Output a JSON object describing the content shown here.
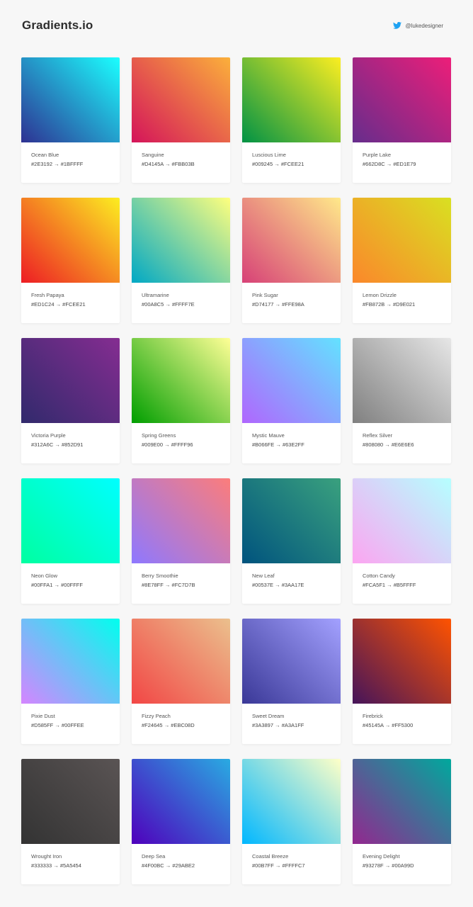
{
  "header": {
    "title": "Gradients.io",
    "twitter_handle": "@lukedesigner",
    "twitter_icon": "twitter-bird-icon",
    "twitter_color": "#1da1f2"
  },
  "gradients": [
    {
      "name": "Ocean Blue",
      "codes": "#2E3192 → #1BFFFF",
      "from": "#2E3192",
      "to": "#1BFFFF"
    },
    {
      "name": "Sanguine",
      "codes": "#D4145A → #FBB03B",
      "from": "#D4145A",
      "to": "#FBB03B"
    },
    {
      "name": "Luscious Lime",
      "codes": "#009245 → #FCEE21",
      "from": "#009245",
      "to": "#FCEE21"
    },
    {
      "name": "Purple Lake",
      "codes": "#662D8C → #ED1E79",
      "from": "#662D8C",
      "to": "#ED1E79"
    },
    {
      "name": "Fresh Papaya",
      "codes": "#ED1C24 → #FCEE21",
      "from": "#ED1C24",
      "to": "#FCEE21"
    },
    {
      "name": "Ultramarine",
      "codes": "#00A8C5 → #FFFF7E",
      "from": "#00A8C5",
      "to": "#FFFF7E"
    },
    {
      "name": "Pink Sugar",
      "codes": "#D74177 → #FFE98A",
      "from": "#D74177",
      "to": "#FFE98A"
    },
    {
      "name": "Lemon Drizzle",
      "codes": "#FB872B → #D9E021",
      "from": "#FB872B",
      "to": "#D9E021"
    },
    {
      "name": "Victoria Purple",
      "codes": "#312A6C → #852D91",
      "from": "#312A6C",
      "to": "#852D91"
    },
    {
      "name": "Spring Greens",
      "codes": "#009E00 → #FFFF96",
      "from": "#009E00",
      "to": "#FFFF96"
    },
    {
      "name": "Mystic Mauve",
      "codes": "#B066FE → #63E2FF",
      "from": "#B066FE",
      "to": "#63E2FF"
    },
    {
      "name": "Reflex Silver",
      "codes": "#808080 → #E6E6E6",
      "from": "#808080",
      "to": "#E6E6E6"
    },
    {
      "name": "Neon Glow",
      "codes": "#00FFA1 → #00FFFF",
      "from": "#00FFA1",
      "to": "#00FFFF"
    },
    {
      "name": "Berry Smoothie",
      "codes": "#8E78FF → #FC7D7B",
      "from": "#8E78FF",
      "to": "#FC7D7B"
    },
    {
      "name": "New Leaf",
      "codes": "#00537E → #3AA17E",
      "from": "#00537E",
      "to": "#3AA17E"
    },
    {
      "name": "Cotton Candy",
      "codes": "#FCA5F1 → #B5FFFF",
      "from": "#FCA5F1",
      "to": "#B5FFFF"
    },
    {
      "name": "Pixie Dust",
      "codes": "#D585FF → #00FFEE",
      "from": "#D585FF",
      "to": "#00FFEE"
    },
    {
      "name": "Fizzy Peach",
      "codes": "#F24645 → #EBC08D",
      "from": "#F24645",
      "to": "#EBC08D"
    },
    {
      "name": "Sweet Dream",
      "codes": "#3A3897 → #A3A1FF",
      "from": "#3A3897",
      "to": "#A3A1FF"
    },
    {
      "name": "Firebrick",
      "codes": "#45145A → #FF5300",
      "from": "#45145A",
      "to": "#FF5300"
    },
    {
      "name": "Wrought Iron",
      "codes": "#333333 → #5A5454",
      "from": "#333333",
      "to": "#5A5454"
    },
    {
      "name": "Deep Sea",
      "codes": "#4F00BC → #29ABE2",
      "from": "#4F00BC",
      "to": "#29ABE2"
    },
    {
      "name": "Coastal Breeze",
      "codes": "#00B7FF → #FFFFC7",
      "from": "#00B7FF",
      "to": "#FFFFC7"
    },
    {
      "name": "Evening Delight",
      "codes": "#93278F → #00A99D",
      "from": "#93278F",
      "to": "#00A99D"
    }
  ]
}
